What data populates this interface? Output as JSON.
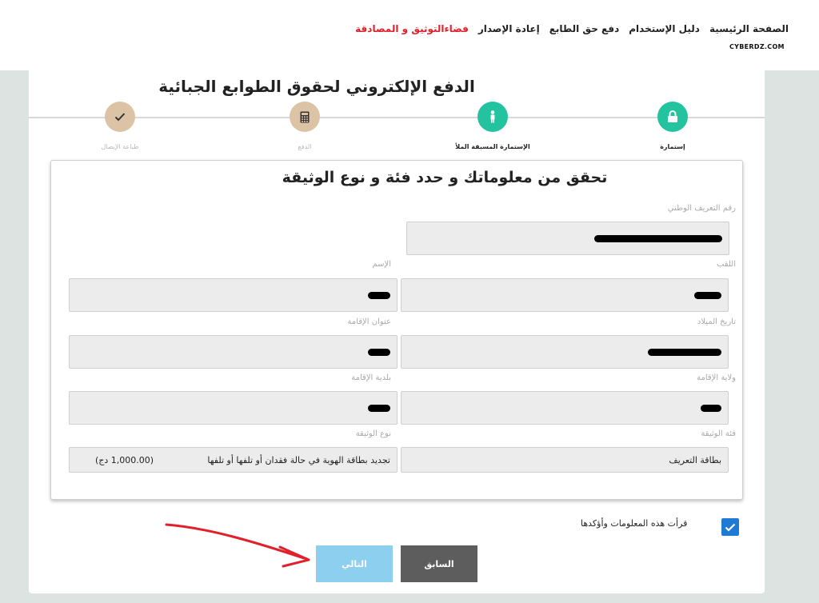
{
  "nav": {
    "items": [
      {
        "label": "الصفحة الرئيسية",
        "active": false
      },
      {
        "label": "دليل الإستخدام",
        "active": false
      },
      {
        "label": "دفع حق الطابع",
        "active": false
      },
      {
        "label": "إعادة الإصدار",
        "active": false
      },
      {
        "label": "فضاءالتوثيق و المصادقة",
        "active": true
      }
    ],
    "brand": "CYBERDZ.COM"
  },
  "page": {
    "title": "الدفع الإلكتروني لحقوق الطوابع الجبائية"
  },
  "steps": [
    {
      "label": "إستمارة",
      "icon": "lock-icon",
      "state": "done"
    },
    {
      "label": "الإستمارة المسبقة الملأ",
      "icon": "person-icon",
      "state": "current"
    },
    {
      "label": "الدفع",
      "icon": "calculator-icon",
      "state": "pending"
    },
    {
      "label": "طباعة الإيصال",
      "icon": "check-icon",
      "state": "pending"
    }
  ],
  "form": {
    "title": "تحقق من معلوماتك و حدد فئة و نوع الوثيقة",
    "national_id_label": "رقم التعريف الوطني",
    "surname_label": "اللقب",
    "first_name_label": "الإسم",
    "birth_date_label": "تاريخ الميلاد",
    "address_label": "عنوان الإقامة",
    "wilaya_label": "ولاية الإقامة",
    "commune_label": "بلدية الإقامة",
    "doc_category_label": "فئة الوثيقة",
    "doc_category_value": "بطاقة التعريف",
    "doc_type_label": "نوع الوثيقة",
    "doc_type_value": "تجديد بطاقة الهوية في حالة فقدان أو تلفها أو تلفها",
    "doc_type_price": "(1,000.00 دج)"
  },
  "confirm": {
    "label": "قرأت هذه المعلومات وأؤكدها",
    "checked": true
  },
  "buttons": {
    "prev": "السابق",
    "next": "التالي"
  },
  "colors": {
    "accent_green": "#23c3a0",
    "step_pending": "#dcc3a6",
    "nav_active": "#e0202a",
    "checkbox": "#1f7ad6",
    "next_button": "#8ccfee",
    "prev_button": "#5d5d5d",
    "annotation_arrow": "#e0202a"
  }
}
